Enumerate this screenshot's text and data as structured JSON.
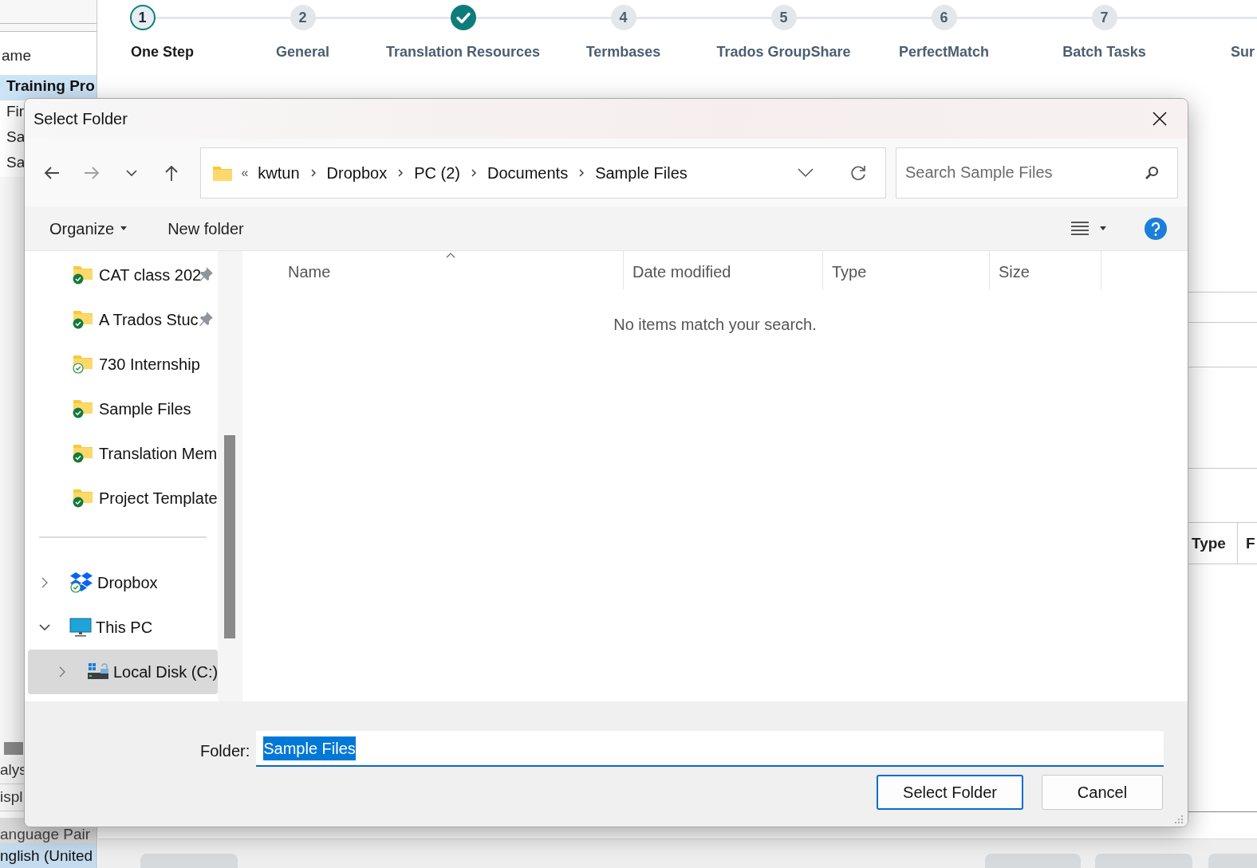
{
  "background": {
    "list_header": "ame",
    "list_rows": [
      {
        "text": "Training Pro",
        "selected": true
      },
      {
        "text": "Fir",
        "selected": false
      },
      {
        "text": "Sa",
        "selected": false
      },
      {
        "text": "Sa",
        "selected": false
      }
    ],
    "lower_rows": [
      {
        "text": "alys",
        "kind": "row",
        "selected": false
      },
      {
        "text": "ispl",
        "kind": "row",
        "selected": false
      },
      {
        "text": "anguage Pair",
        "kind": "header"
      },
      {
        "text": "nglish (United",
        "kind": "row",
        "selected": true
      }
    ],
    "right_headers": [
      "Type",
      "F"
    ]
  },
  "steps": [
    {
      "kind": "step",
      "number": "1",
      "label": "One Step",
      "current": true,
      "completed": false
    },
    {
      "kind": "step",
      "number": "2",
      "label": "General",
      "current": false,
      "completed": false
    },
    {
      "kind": "step",
      "label": "Translation Resources",
      "current": false,
      "completed": true
    },
    {
      "kind": "step",
      "number": "4",
      "label": "Termbases",
      "current": false,
      "completed": false
    },
    {
      "kind": "step",
      "number": "5",
      "label": "Trados GroupShare",
      "current": false,
      "completed": false
    },
    {
      "kind": "step",
      "number": "6",
      "label": "PerfectMatch",
      "current": false,
      "completed": false
    },
    {
      "kind": "step",
      "number": "7",
      "label": "Batch Tasks",
      "current": false,
      "completed": false
    },
    {
      "kind": "partial",
      "label": "Sur"
    }
  ],
  "dialog": {
    "title": "Select Folder",
    "nav": {
      "back_disabled": false,
      "forward_disabled": true
    },
    "address": {
      "overflow": "«",
      "crumbs": [
        "kwtun",
        "Dropbox",
        "PC (2)",
        "Documents",
        "Sample Files"
      ]
    },
    "search": {
      "placeholder": "Search Sample Files"
    },
    "toolbar": {
      "organize": "Organize",
      "new_folder": "New folder"
    },
    "quick_access": [
      {
        "label": "CAT class 202",
        "always_on_device": true,
        "pinned": true
      },
      {
        "label": "A Trados Stuc",
        "always_on_device": true,
        "pinned": true
      },
      {
        "label": "730 Internship",
        "always_on_device": false,
        "pinned": false
      },
      {
        "label": "Sample Files",
        "always_on_device": true,
        "pinned": false
      },
      {
        "label": "Translation Mem",
        "always_on_device": true,
        "pinned": false
      },
      {
        "label": "Project Template",
        "always_on_device": true,
        "pinned": false
      }
    ],
    "tree": [
      {
        "label": "Dropbox",
        "kind": "dropbox",
        "expanded": false,
        "selected": false
      },
      {
        "label": "This PC",
        "kind": "pc",
        "expanded": true,
        "selected": false,
        "children": [
          {
            "label": "Local Disk (C:)",
            "kind": "disk",
            "expanded": false,
            "selected": true
          }
        ]
      }
    ],
    "columns": [
      "Name",
      "Date modified",
      "Type",
      "Size"
    ],
    "empty_message": "No items match your search.",
    "folder_label": "Folder:",
    "folder_value": "Sample Files",
    "buttons": [
      {
        "label": "Select Folder",
        "default": true
      },
      {
        "label": "Cancel",
        "default": false
      }
    ]
  }
}
